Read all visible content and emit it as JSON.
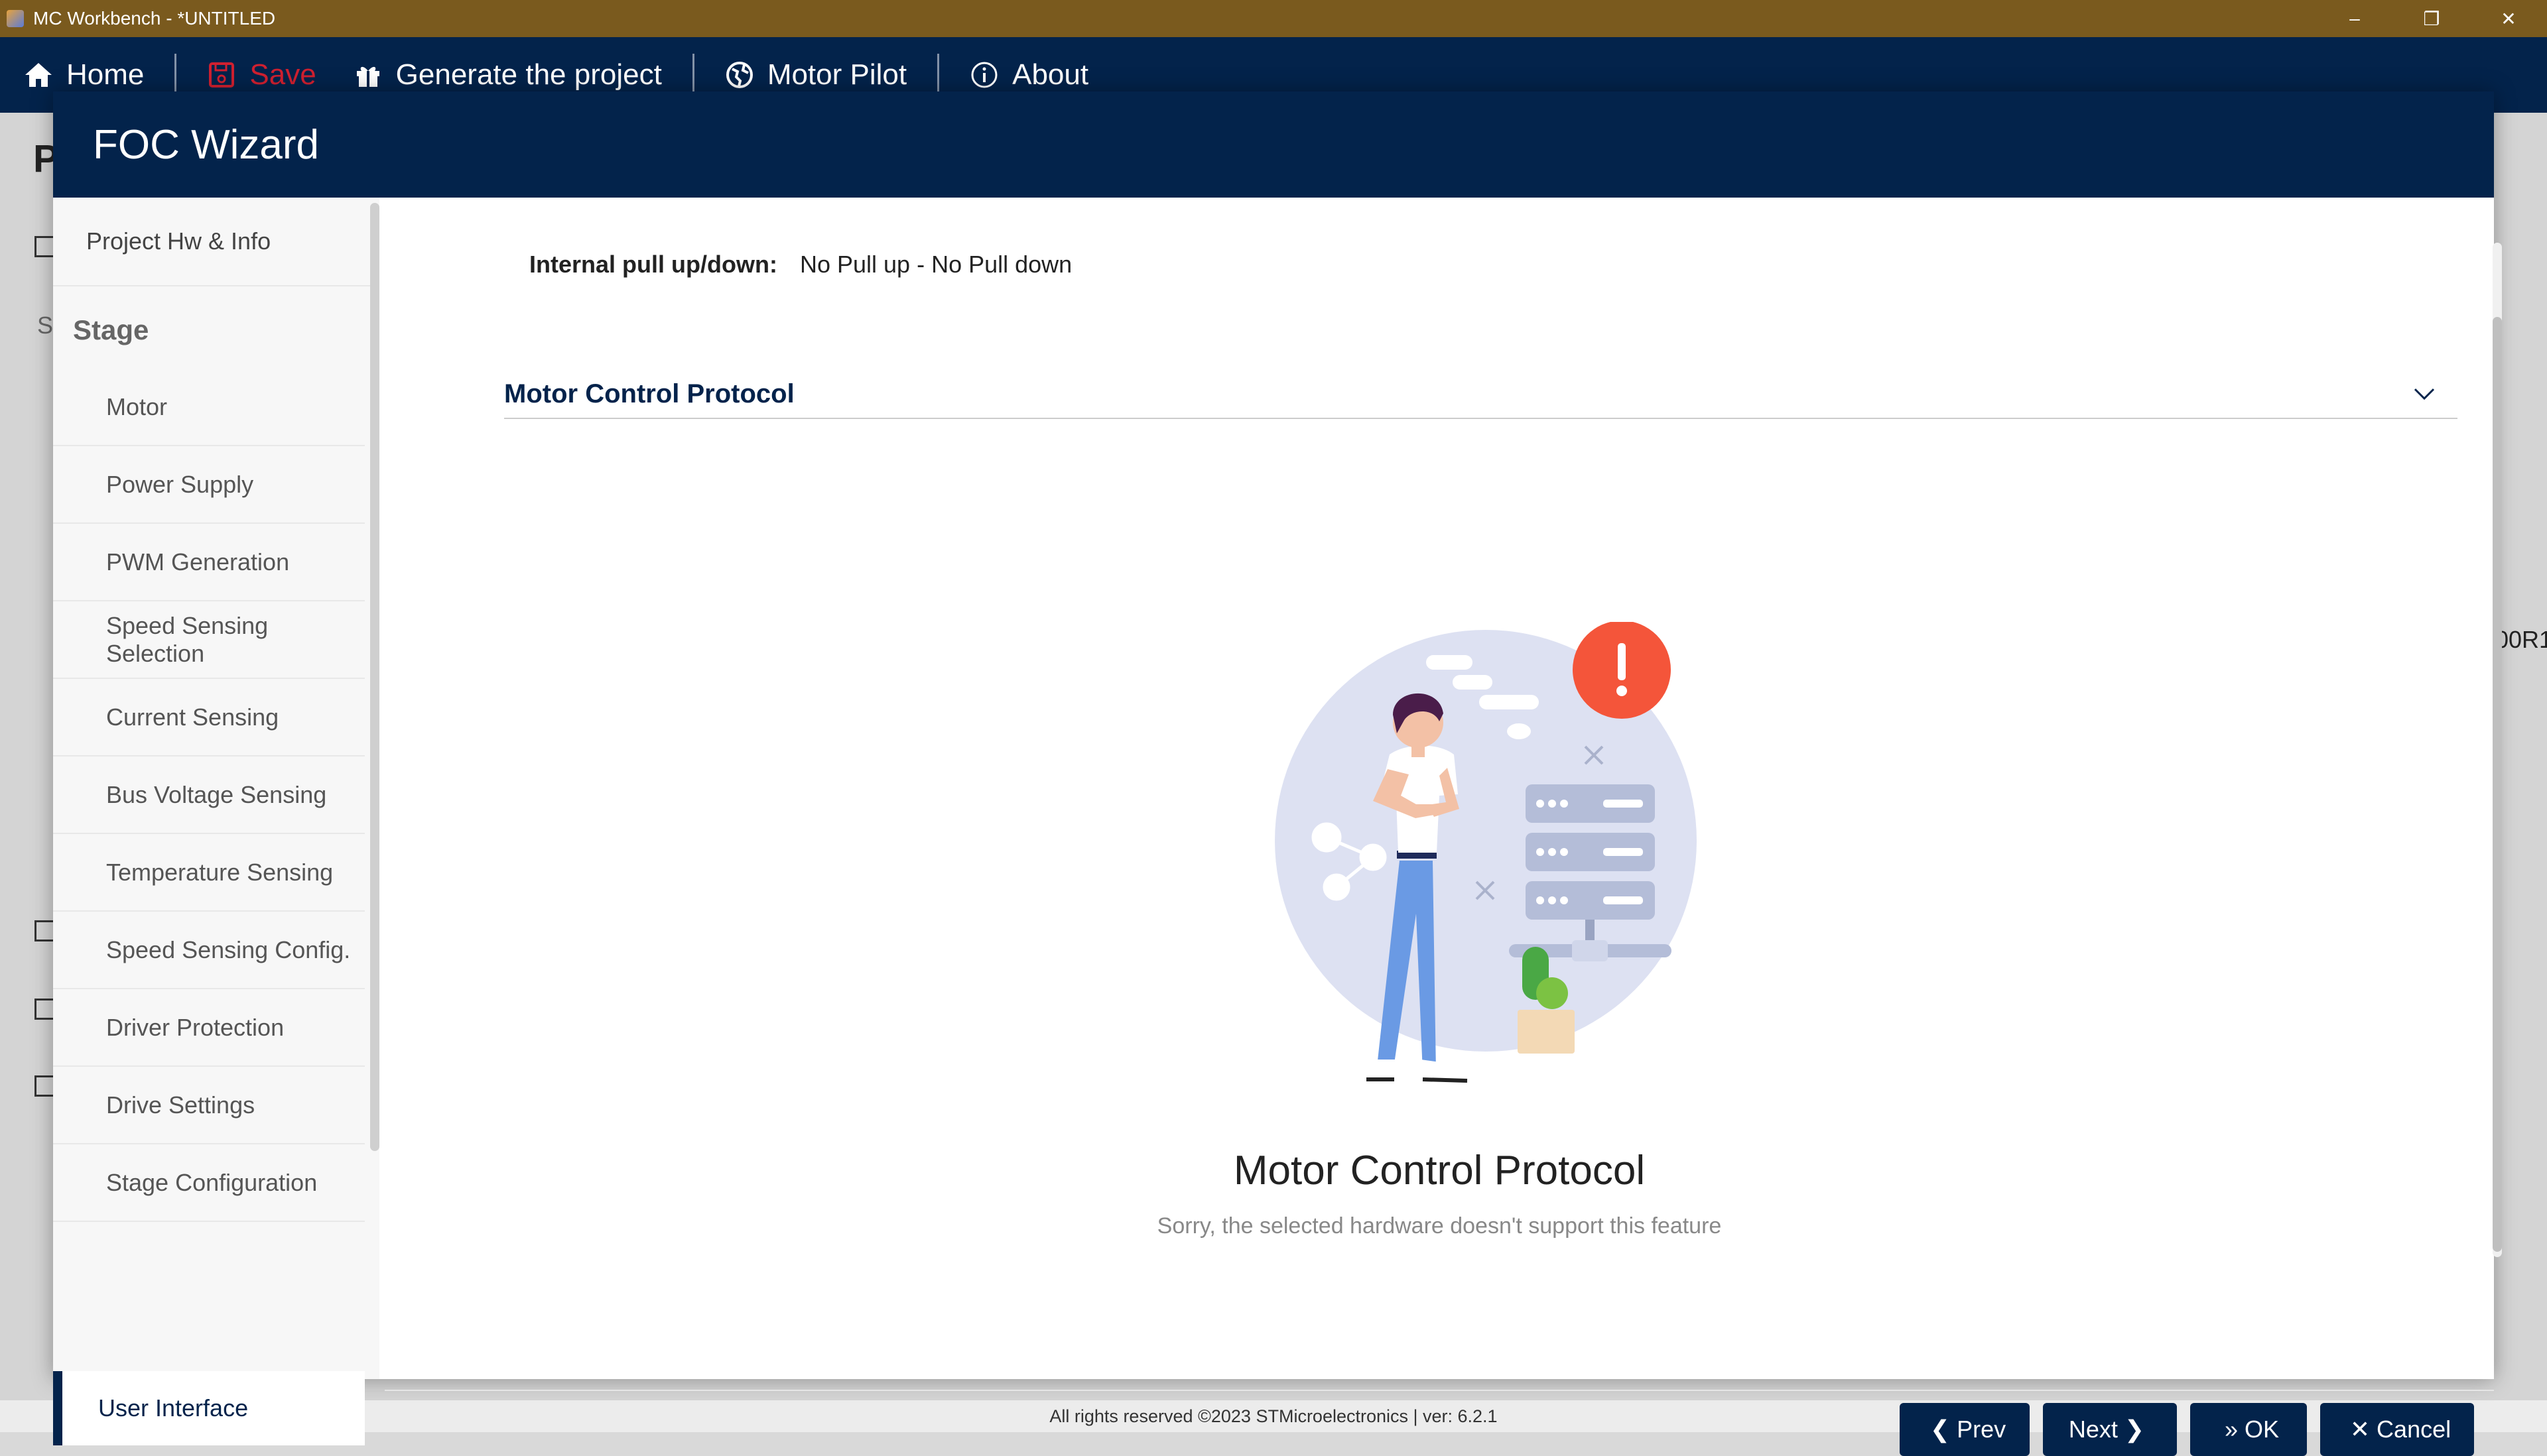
{
  "window": {
    "title": "MC Workbench - *UNTITLED"
  },
  "nav": {
    "home": "Home",
    "save": "Save",
    "generate": "Generate the project",
    "motor_pilot": "Motor Pilot",
    "about": "About"
  },
  "background": {
    "page_letter": "P",
    "frag_s": "S",
    "frag_right": "00R1",
    "footer": "All rights reserved ©2023 STMicroelectronics | ver: 6.2.1"
  },
  "modal": {
    "title": "FOC Wizard",
    "sidebar": {
      "header": "Project Hw & Info",
      "stage_label": "Stage",
      "items": [
        "Motor",
        "Power Supply",
        "PWM Generation",
        "Speed Sensing Selection",
        "Current Sensing",
        "Bus Voltage Sensing",
        "Temperature Sensing",
        "Speed Sensing Config.",
        "Driver Protection",
        "Drive Settings",
        "Stage Configuration"
      ],
      "active_item": "User Interface"
    },
    "content": {
      "pull_label": "Internal pull up/down:",
      "pull_value": "No Pull up - No Pull down",
      "section_title": "Motor Control Protocol",
      "empty_title": "Motor Control Protocol",
      "empty_message": "Sorry, the selected hardware doesn't support this feature"
    },
    "buttons": {
      "prev": "Prev",
      "next": "Next",
      "ok": "OK",
      "cancel": "Cancel"
    }
  },
  "colors": {
    "navy": "#03234b",
    "titlebar": "#7a5a1e",
    "save_red": "#d02030",
    "alert_orange": "#f4553a"
  }
}
